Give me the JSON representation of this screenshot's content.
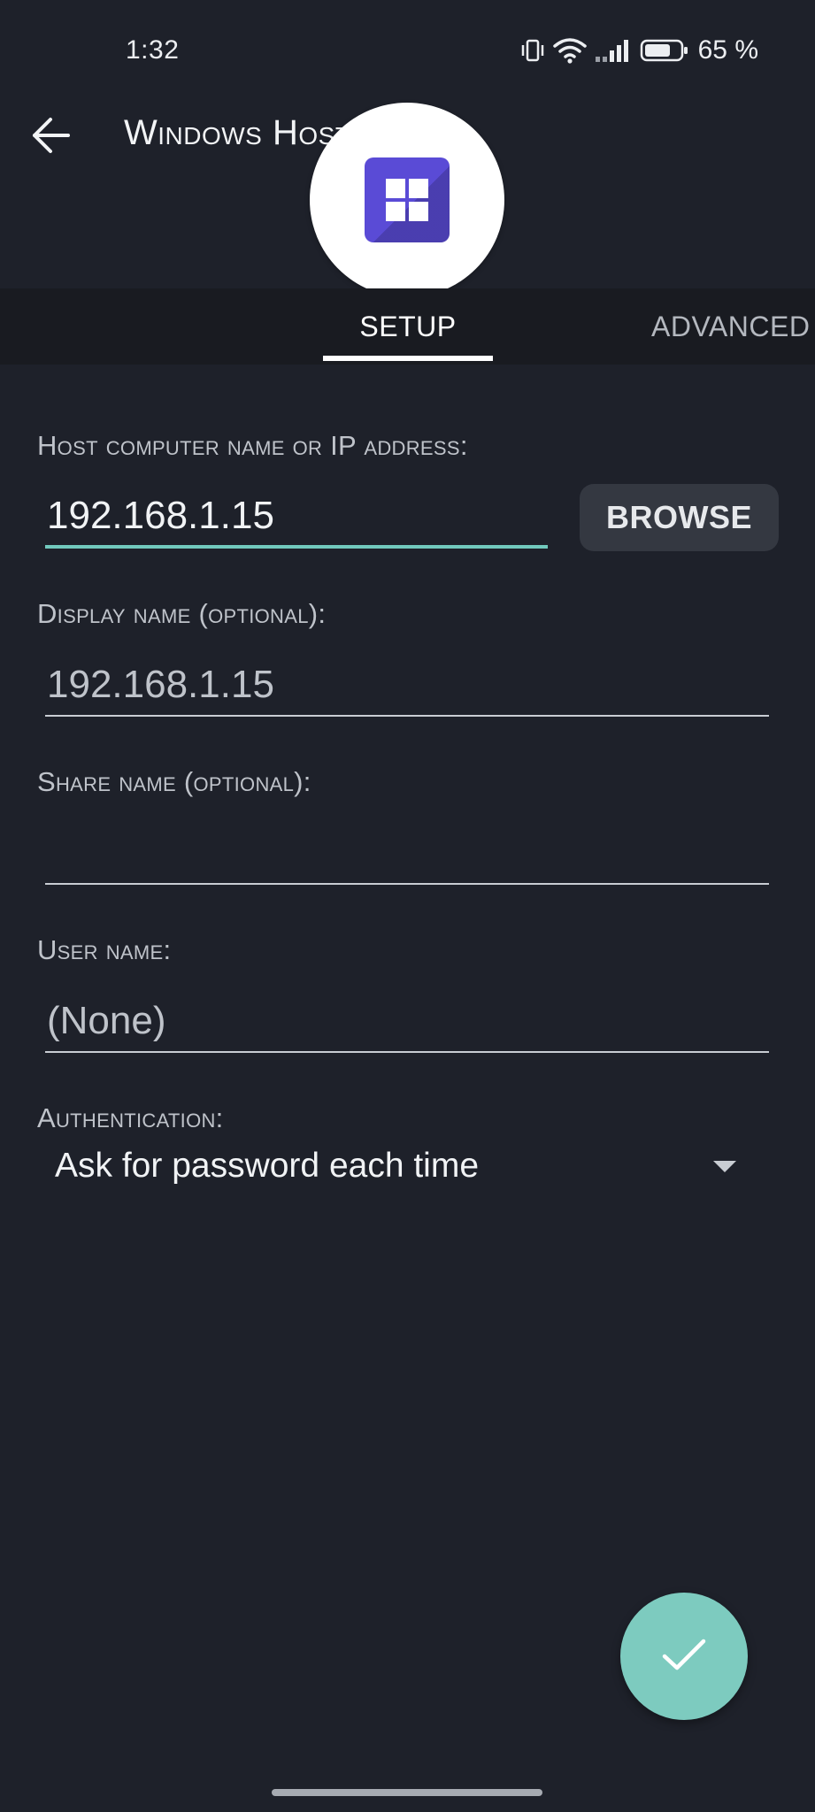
{
  "status_bar": {
    "time": "1:32",
    "battery": "65 %",
    "icons": [
      "vibrate-icon",
      "wifi-icon",
      "signal-icon",
      "battery-icon"
    ]
  },
  "app_bar": {
    "title": "Windows Host (SMB)",
    "back_icon": "arrow-back-icon",
    "logo_icon": "windows-logo-icon"
  },
  "tabs": {
    "setup": "SETUP",
    "advanced": "ADVANCED",
    "selected": "SETUP"
  },
  "form": {
    "host": {
      "label": "Host computer name or IP address:",
      "value": "192.168.1.15"
    },
    "browse_label": "BROWSE",
    "display_name": {
      "label": "Display name (optional):",
      "value": "192.168.1.15"
    },
    "share_name": {
      "label": "Share name (optional):",
      "value": ""
    },
    "user_name": {
      "label": "User name:",
      "value": "(None)"
    },
    "authentication": {
      "label": "Authentication:",
      "value": "Ask for password each time"
    }
  },
  "fab": {
    "icon": "check-icon"
  },
  "colors": {
    "background": "#1E212A",
    "tab_strip": "#191B21",
    "accent": "#71C9BD",
    "fab": "#7DCBBF",
    "logo": "#5A4BD6"
  }
}
